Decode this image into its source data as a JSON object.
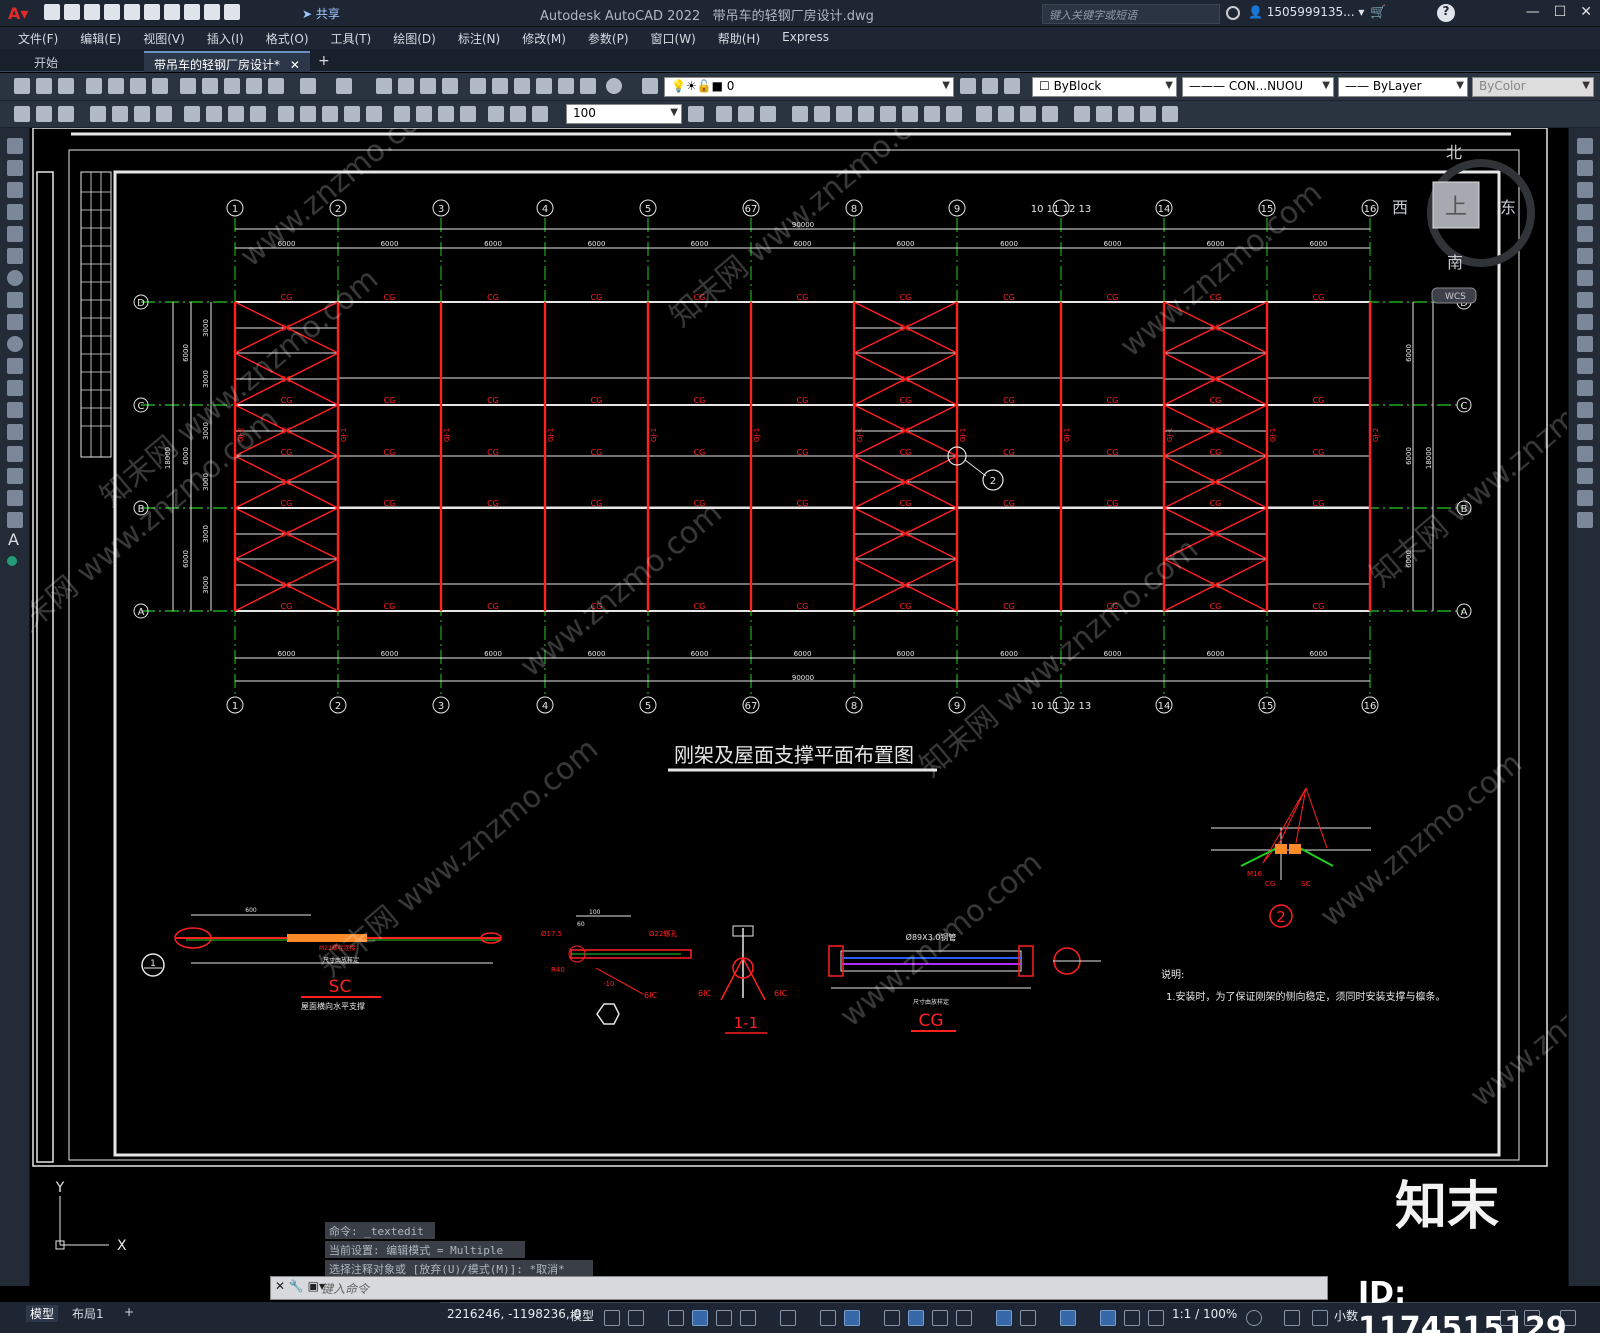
{
  "app": {
    "title": "Autodesk AutoCAD 2022",
    "filename": "带吊车的轻钢厂房设计.dwg",
    "share_label": "共享"
  },
  "search": {
    "placeholder": "键入关键字或短语"
  },
  "user": {
    "name": "1505999135..."
  },
  "menu": [
    "文件(F)",
    "编辑(E)",
    "视图(V)",
    "插入(I)",
    "格式(O)",
    "工具(T)",
    "绘图(D)",
    "标注(N)",
    "修改(M)",
    "参数(P)",
    "窗口(W)",
    "帮助(H)",
    "Express"
  ],
  "tabs": {
    "start": "开始",
    "doc": "带吊车的轻钢厂房设计*"
  },
  "toolbar": {
    "layer_value": "0",
    "color_value": "ByBlock",
    "linetype_value": "CON...NUOU",
    "lineweight_value": "ByLayer",
    "plotstyle_value": "ByColor",
    "dimscale_value": "100"
  },
  "viewcube": {
    "north": "北",
    "south": "南",
    "west": "西",
    "east": "东",
    "face": "上",
    "wcs": "WCS"
  },
  "drawing": {
    "grid_labels_top": [
      "1",
      "2",
      "3",
      "4",
      "5",
      "67",
      "8",
      "9",
      "10 11 12 13",
      "14",
      "15",
      "16"
    ],
    "row_labels": [
      "D",
      "C",
      "B",
      "A"
    ],
    "span_dim": "6000",
    "total_dim": "90000",
    "left_dims": [
      "6000",
      "6000",
      "6000"
    ],
    "left_small_dims": [
      "3000",
      "3000",
      "3000",
      "3000",
      "3000",
      "3000"
    ],
    "total_side_dim": "18000",
    "right_dims": [
      "6000",
      "6000",
      "6000"
    ],
    "cg_label": "CG",
    "sc_label": "SC",
    "gj_label_1": "GJ-1",
    "gj_label_2": "GJ-2",
    "plan_title": "刚架及屋面支撑平面布置图",
    "detail_sc_title": "SC",
    "detail_sc_sub": "屋面横向水平支撑",
    "detail_sc_dim": "尺寸由放样定",
    "detail_sc_bolt": "M22螺栓连接",
    "detail_sc_top_dim": "600",
    "detail_11": "1-1",
    "detail_cg_title": "CG",
    "detail_cg_spec": "Ø89X3.0钢管",
    "detail_cg_dim": "尺寸由放样定",
    "detail_2_num": "2",
    "detail_1_num": "1",
    "small_label_6ic": "6IC",
    "small_label_m16": "M16",
    "small_label_r40": "R40",
    "small_label_d175": "Ø17.5",
    "small_label_d22": "Ø22螺孔",
    "small_label_100": "100",
    "small_label_60": "60",
    "small_label_10": "-10",
    "note_head": "说明:",
    "note_1": "1.安装时，为了保证刚架的侧向稳定，须同时安装支撑与檩条。"
  },
  "command": {
    "line1": "命令: _textedit",
    "line2": "当前设置: 编辑模式 = Multiple",
    "line3": "选择注释对象或 [放弃(U)/模式(M)]: *取消*",
    "input_placeholder": "键入命令"
  },
  "ucs": {
    "x": "X",
    "y": "Y"
  },
  "layout_tabs": {
    "model": "模型",
    "layout1": "布局1",
    "add": "+"
  },
  "status": {
    "coords": "2216246, -1198236, 0",
    "space": "模型",
    "scale": "1:1 / 100%",
    "units": "小数"
  },
  "watermark": {
    "brand": "知末",
    "id": "ID: 1174515129",
    "site": "www.znzmo.com",
    "cn": "知末网"
  },
  "colors": {
    "canvas": "#000000",
    "steel_red": "#ff2020",
    "axis_green": "#22cc22",
    "dim_white": "#e6e6e6"
  }
}
